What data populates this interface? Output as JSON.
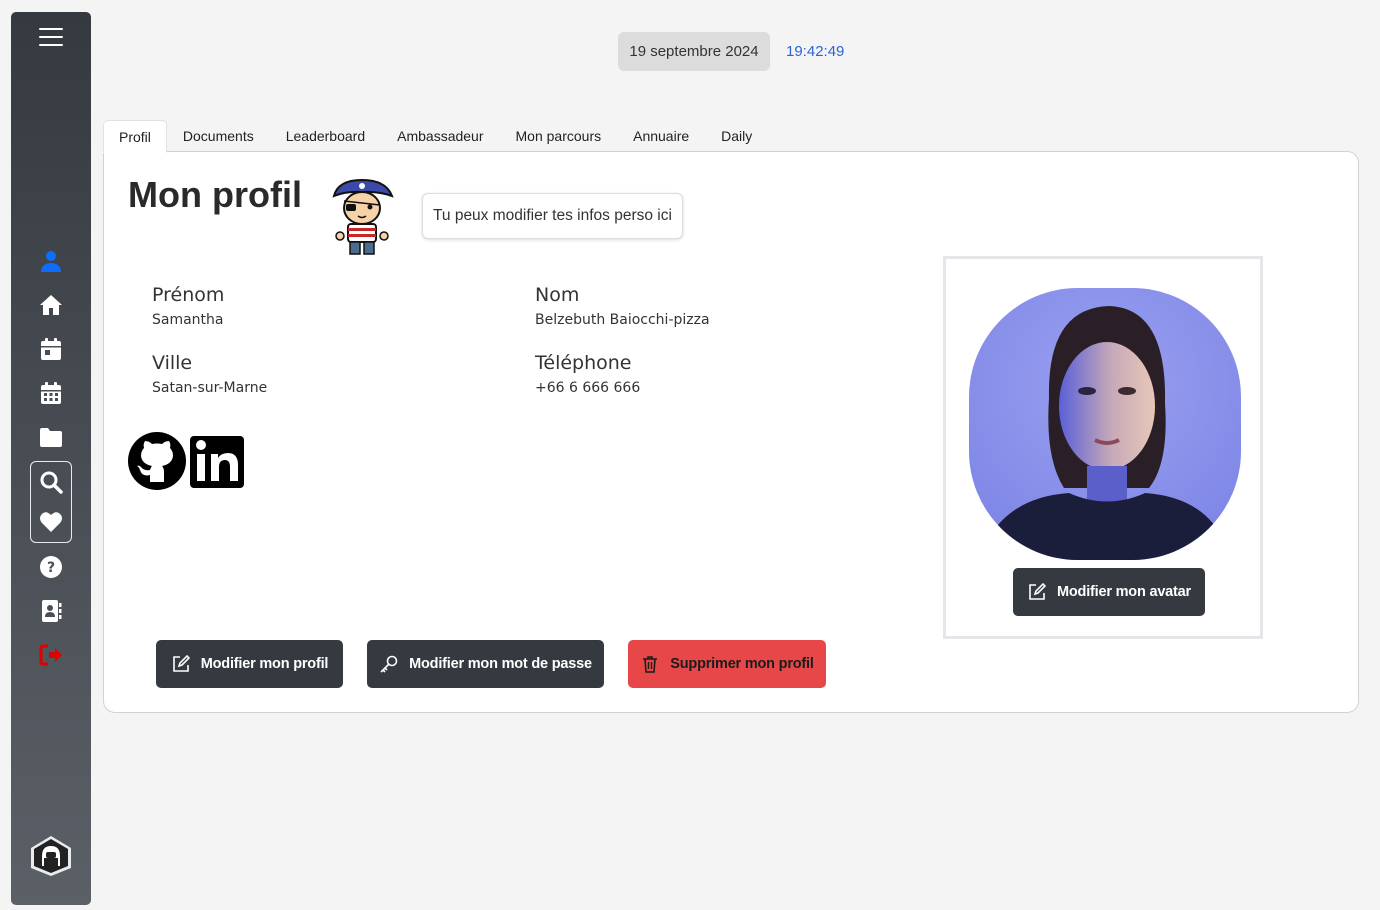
{
  "header": {
    "date": "19 septembre 2024",
    "time": "19:42:49"
  },
  "tabs": [
    {
      "label": "Profil",
      "active": true
    },
    {
      "label": "Documents",
      "active": false
    },
    {
      "label": "Leaderboard",
      "active": false
    },
    {
      "label": "Ambassadeur",
      "active": false
    },
    {
      "label": "Mon parcours",
      "active": false
    },
    {
      "label": "Annuaire",
      "active": false
    },
    {
      "label": "Daily",
      "active": false
    }
  ],
  "sidebar": {
    "items": [
      {
        "icon": "user-icon",
        "color": "#0d6efd"
      },
      {
        "icon": "home-icon",
        "color": "#ffffff"
      },
      {
        "icon": "calendar-day-icon",
        "color": "#ffffff"
      },
      {
        "icon": "calendar-icon",
        "color": "#ffffff"
      },
      {
        "icon": "folder-icon",
        "color": "#ffffff"
      },
      {
        "icon": "search-icon",
        "color": "#ffffff"
      },
      {
        "icon": "heart-icon",
        "color": "#ffffff"
      },
      {
        "icon": "help-icon",
        "color": "#ffffff"
      },
      {
        "icon": "contact-book-icon",
        "color": "#ffffff"
      },
      {
        "icon": "logout-icon",
        "color": "#e00000"
      }
    ]
  },
  "profile": {
    "title": "Mon profil",
    "hint": "Tu peux modifier tes infos perso ici",
    "fields": {
      "firstname": {
        "label": "Prénom",
        "value": "Samantha"
      },
      "lastname": {
        "label": "Nom",
        "value": "Belzebuth Baiocchi-pizza"
      },
      "city": {
        "label": "Ville",
        "value": "Satan-sur-Marne"
      },
      "phone": {
        "label": "Téléphone",
        "value": "+66 6 666 666"
      }
    },
    "social": [
      "github-icon",
      "linkedin-icon"
    ]
  },
  "avatar": {
    "edit_label": "Modifier mon avatar"
  },
  "actions": {
    "edit_profile": "Modifier mon profil",
    "edit_password": "Modifier mon mot de passe",
    "delete_profile": "Supprimer mon profil"
  },
  "colors": {
    "accent": "#0d6efd",
    "danger": "#e8474a",
    "dark": "#343a40",
    "time": "#2b63d6"
  }
}
